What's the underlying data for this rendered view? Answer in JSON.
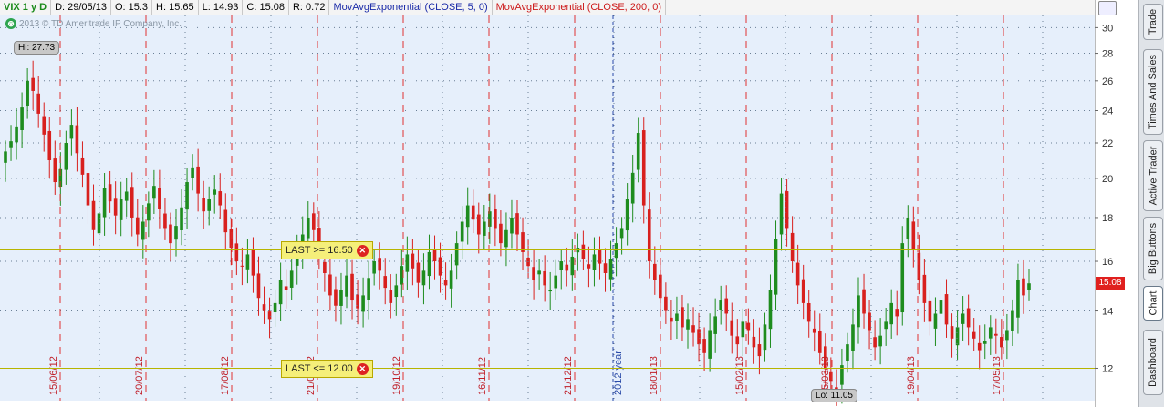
{
  "header": {
    "symbol": "VIX 1 y D",
    "date": "D: 29/05/13",
    "open": "O: 15.3",
    "high": "H: 15.65",
    "low": "L: 14.93",
    "close": "C: 15.08",
    "range": "R: 0.72",
    "study_fast": "MovAvgExponential (CLOSE, 5, 0)",
    "study_slow": "MovAvgExponential (CLOSE, 200, 0)"
  },
  "watermark": "2013 © TD Ameritrade IP Company, Inc.",
  "high_bubble": "Hi: 27.73",
  "low_bubble": "Lo: 11.05",
  "alerts": [
    {
      "label": "LAST >= 16.50",
      "level": 16.5
    },
    {
      "label": "LAST <= 12.00",
      "level": 12.0
    }
  ],
  "last_price": "15.08",
  "year_marker": "2012 year",
  "sidebar": {
    "tabs": [
      "Trade",
      "Times And Sales",
      "Active Trader",
      "Big Buttons",
      "Chart",
      "Dashboard"
    ],
    "active": "Chart"
  },
  "colors": {
    "up": "#1e8c1e",
    "down": "#d8201e",
    "alert_line": "#b7b400",
    "grid": "#6a7f95",
    "divider": "#e03030",
    "background": "#e6effb"
  },
  "chart_data": {
    "type": "candlestick",
    "ylim": [
      11,
      31
    ],
    "y_ticks": [
      12,
      14,
      16,
      18,
      20,
      22,
      24,
      26,
      28,
      30
    ],
    "x_labels": [
      "15/06/12",
      "20/07/12",
      "17/08/12",
      "21/09/12",
      "19/10/12",
      "16/11/12",
      "21/12/12",
      "18/01/13",
      "15/02/13",
      "15/03/13",
      "19/04/13",
      "17/05/13"
    ],
    "high": 27.73,
    "low": 11.05,
    "last_close": 15.08,
    "series": [
      {
        "closes": [
          21.5,
          22.1,
          23.0,
          24.2,
          26.0,
          25.3,
          23.8,
          22.5,
          21.0,
          19.8,
          20.5,
          22.0,
          23.1,
          21.4,
          20.2,
          18.6,
          17.4,
          18.2,
          19.5,
          18.8,
          18.1,
          18.9,
          19.3,
          18.0,
          17.2,
          17.8,
          18.7,
          19.6,
          18.4,
          17.5,
          16.8,
          17.6,
          18.5,
          19.8,
          20.6,
          19.2,
          18.3,
          18.9,
          19.4,
          18.6,
          17.3,
          16.6,
          16.0,
          15.8,
          16.3,
          15.4,
          14.5,
          14.0,
          13.7,
          14.3,
          15.2,
          14.8,
          15.6,
          16.5,
          17.2,
          18.0,
          17.4,
          16.2,
          15.5,
          14.6,
          14.2,
          14.8,
          15.4,
          14.4,
          14.1,
          14.6,
          15.3,
          16.0,
          15.6,
          14.9,
          14.3,
          15.0,
          15.8,
          16.3,
          15.7,
          15.1,
          15.6,
          16.4,
          16.0,
          15.4,
          15.0,
          15.6,
          16.8,
          17.8,
          18.6,
          17.9,
          17.2,
          17.8,
          18.3,
          17.5,
          16.8,
          17.4,
          18.0,
          17.2,
          16.4,
          15.8,
          15.2,
          15.6,
          15.0,
          14.8,
          15.4,
          16.0,
          15.6,
          16.2,
          16.6,
          16.1,
          15.7,
          16.3,
          15.9,
          15.5,
          16.1,
          16.8,
          17.5,
          18.9,
          20.3,
          22.6,
          18.6,
          16.0,
          15.2,
          14.5,
          14.0,
          13.6,
          13.9,
          13.4,
          13.7,
          13.2,
          12.8,
          12.5,
          13.3,
          13.8,
          14.4,
          13.9,
          13.1,
          12.8,
          13.6,
          13.3,
          12.7,
          12.4,
          13.5,
          14.8,
          17.0,
          19.2,
          17.5,
          16.0,
          15.0,
          14.3,
          13.6,
          13.2,
          12.5,
          12.0,
          11.6,
          11.3,
          12.1,
          12.8,
          13.5,
          14.6,
          13.9,
          13.3,
          12.7,
          13.1,
          13.6,
          14.3,
          13.8,
          16.8,
          18.0,
          16.5,
          15.2,
          14.3,
          13.6,
          13.9,
          14.4,
          13.5,
          13.0,
          13.4,
          13.9,
          13.4,
          13.0,
          12.6,
          12.9,
          13.4,
          13.1,
          12.7,
          13.3,
          14.0,
          15.2,
          14.6,
          15.08
        ]
      }
    ]
  }
}
